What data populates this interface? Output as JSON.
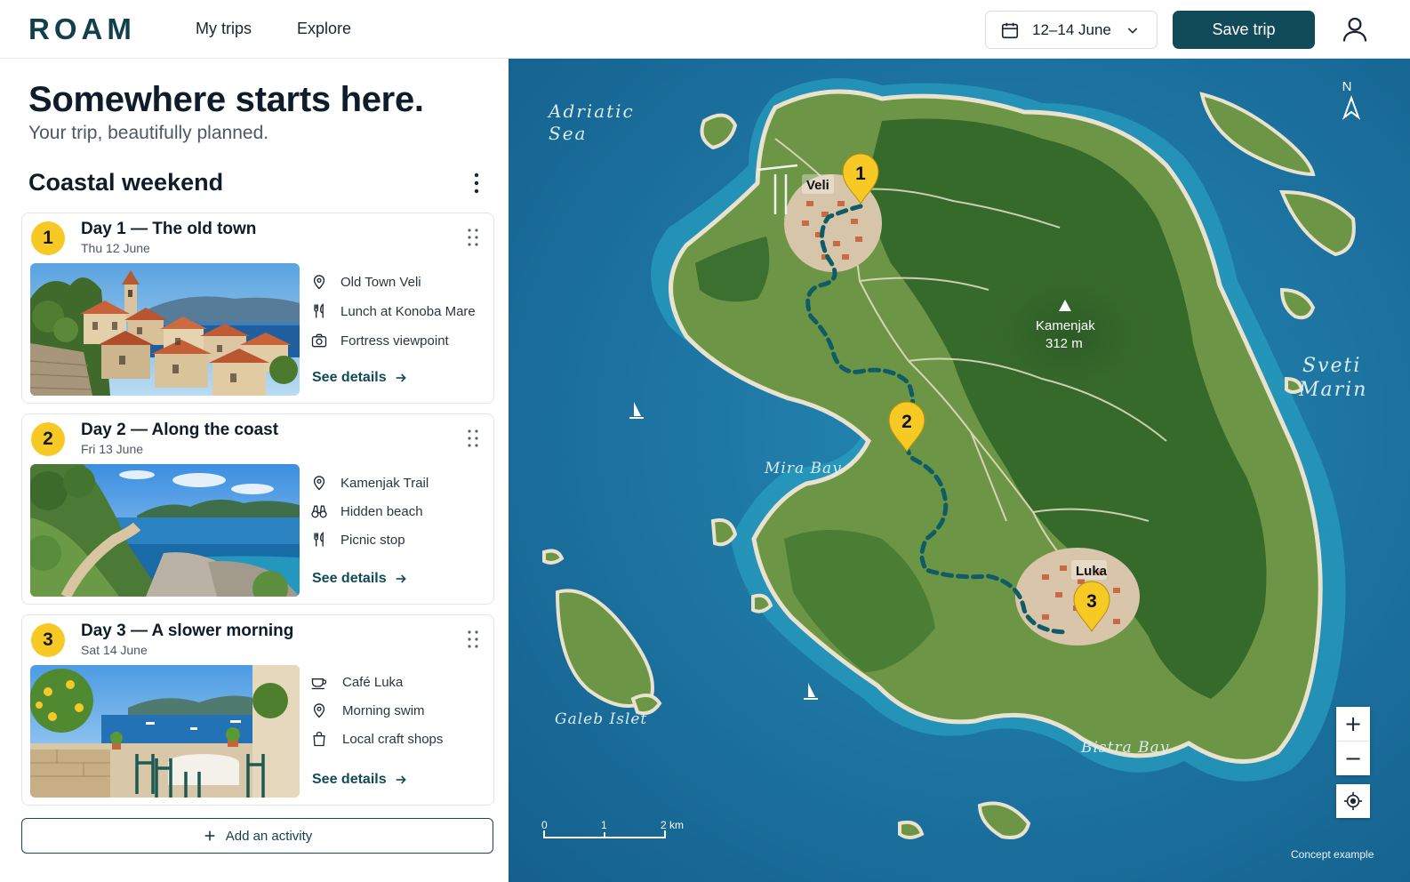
{
  "header": {
    "logo": "ROAM",
    "nav": [
      "My trips",
      "Explore"
    ],
    "date_range": "12–14 June",
    "save_label": "Save trip"
  },
  "hero": {
    "title": "Somewhere starts here.",
    "subtitle": "Your trip, beautifully planned."
  },
  "trip": {
    "title": "Coastal weekend",
    "days": [
      {
        "number": "1",
        "title": "Day 1 — The old town",
        "date": "Thu 12 June",
        "activities": [
          {
            "icon": "pin-icon",
            "label": "Old Town Veli"
          },
          {
            "icon": "fork-knife-icon",
            "label": "Lunch at Konoba Mare"
          },
          {
            "icon": "camera-icon",
            "label": "Fortress viewpoint"
          }
        ],
        "details_label": "See details"
      },
      {
        "number": "2",
        "title": "Day 2 — Along the coast",
        "date": "Fri 13 June",
        "activities": [
          {
            "icon": "pin-icon",
            "label": "Kamenjak Trail"
          },
          {
            "icon": "binoculars-icon",
            "label": "Hidden beach"
          },
          {
            "icon": "fork-knife-icon",
            "label": "Picnic stop"
          }
        ],
        "details_label": "See details"
      },
      {
        "number": "3",
        "title": "Day 3 — A slower morning",
        "date": "Sat 14 June",
        "activities": [
          {
            "icon": "coffee-cup-icon",
            "label": "Café Luka"
          },
          {
            "icon": "pin-icon",
            "label": "Morning swim"
          },
          {
            "icon": "shopping-bag-icon",
            "label": "Local craft shops"
          }
        ],
        "details_label": "See details"
      }
    ],
    "add_label": "Add an activity"
  },
  "map": {
    "labels": {
      "adriatic_1": "Adriatic",
      "adriatic_2": "Sea",
      "sveti_1": "Sveti",
      "sveti_2": "Marin",
      "mira_bay": "Mira Bay",
      "galeb_islet": "Galeb Islet",
      "bistra_bay": "Bistra Bay",
      "veli": "Veli",
      "luka": "Luka",
      "peak_name": "Kamenjak",
      "peak_height": "312 m"
    },
    "markers": [
      "1",
      "2",
      "3"
    ],
    "compass": "N",
    "scale": [
      "0",
      "1",
      "2 km"
    ],
    "zoom_in": "+",
    "zoom_out": "−",
    "footnote": "Concept example",
    "colors": {
      "sea": "#1c6e9a",
      "land": "#5e8a3f",
      "forest": "#2f5f2a",
      "route": "#0f5c66",
      "marker": "#f7c925"
    }
  }
}
